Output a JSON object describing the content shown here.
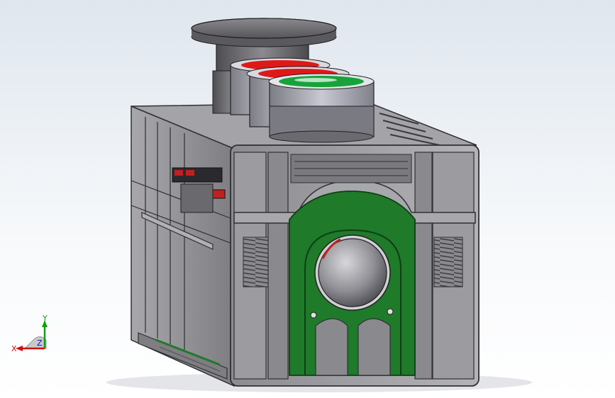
{
  "viewport": {
    "background_top": "#dfe6ee",
    "background_bottom": "#ffffff"
  },
  "model": {
    "housing_color": "#9a9a9e",
    "board_color": "#1f7a2a",
    "button_red": "#e01818",
    "button_green": "#17a33a",
    "cap_color": "#6e6e72"
  },
  "triad": {
    "x_label": "X",
    "y_label": "Y",
    "z_label": "Z",
    "x_color": "#d01010",
    "y_color": "#10a010",
    "z_color": "#1010c0"
  }
}
